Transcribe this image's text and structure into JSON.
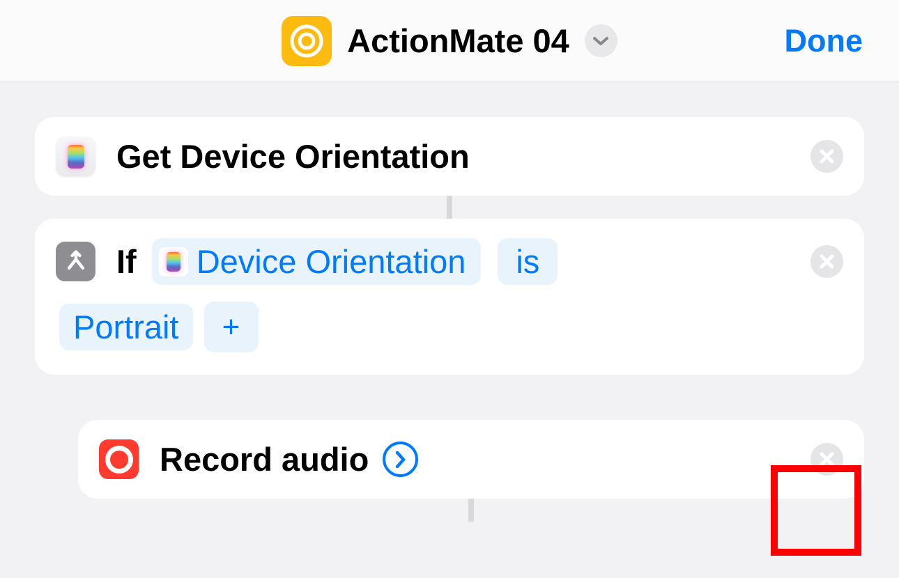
{
  "header": {
    "title": "ActionMate 04",
    "done_label": "Done"
  },
  "actions": {
    "get_orientation": {
      "title": "Get Device Orientation"
    },
    "if_block": {
      "label": "If",
      "variable": "Device Orientation",
      "condition": "is",
      "value": "Portrait",
      "add_symbol": "+"
    },
    "record_audio": {
      "title": "Record audio"
    }
  }
}
